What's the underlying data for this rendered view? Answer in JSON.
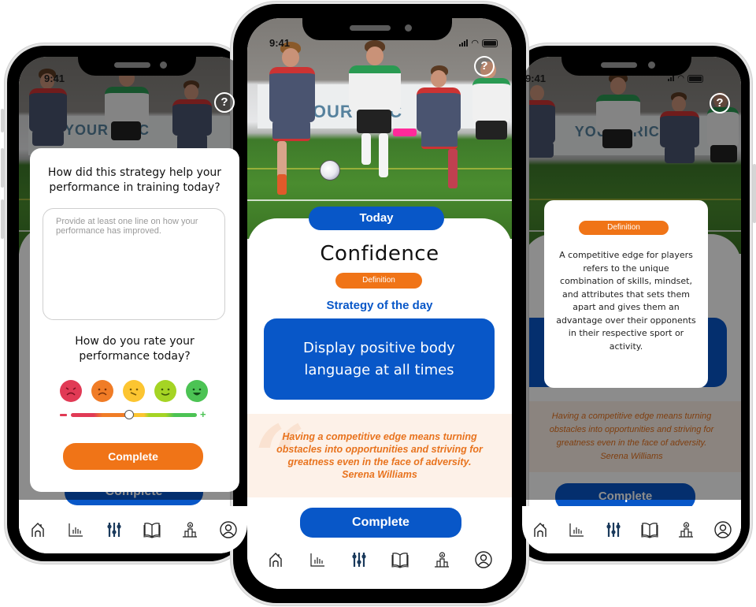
{
  "status_bar": {
    "time": "9:41"
  },
  "left_phone": {
    "help_label": "?",
    "feedback_sheet": {
      "question_1": "How did this strategy help your performance in training today?",
      "textarea_placeholder": "Provide at least one line on how your performance has improved.",
      "textarea_value": "",
      "question_2": "How do you rate your performance today?",
      "rating_options": [
        "very-bad",
        "bad",
        "neutral",
        "good",
        "very-good"
      ],
      "slider_min_label": "−",
      "slider_max_label": "+",
      "slider_value_fraction": 0.46,
      "complete_label": "Complete"
    },
    "background_complete_label": "Complete"
  },
  "center_phone": {
    "help_label": "?",
    "today_label": "Today",
    "skill_title": "Confidence",
    "definition_label": "Definition",
    "strategy_heading": "Strategy of the day",
    "strategy_text": "Display positive body language at all times",
    "quote": {
      "text": "Having a competitive edge means turning obstacles into opportunities and striving for greatness even in the face of adversity.",
      "author": "Serena Williams"
    },
    "complete_label": "Complete"
  },
  "right_phone": {
    "help_label": "?",
    "definition_popup": {
      "label": "Definition",
      "text": "A competitive edge for players refers to the unique combination of skills, mindset, and attributes that sets them apart and gives them an advantage over their opponents in their respective sport or activity."
    },
    "quote": {
      "text": "Having a competitive edge means turning obstacles into opportunities and striving for greatness even in the face of adversity.",
      "author": "Serena Williams"
    },
    "complete_label": "Complete"
  },
  "nav_items": [
    {
      "name": "home",
      "icon": "home-icon",
      "active": false
    },
    {
      "name": "stats",
      "icon": "bar-chart-icon",
      "active": false
    },
    {
      "name": "strategies",
      "icon": "sliders-icon",
      "active": true
    },
    {
      "name": "library",
      "icon": "book-icon",
      "active": false
    },
    {
      "name": "leaderboard",
      "icon": "podium-icon",
      "active": false
    },
    {
      "name": "profile",
      "icon": "user-circle-icon",
      "active": false
    }
  ],
  "colors": {
    "primary_blue": "#0857c8",
    "accent_orange": "#f07417",
    "quote_bg": "#fdf1e8",
    "nav_active": "#1a3a5c"
  }
}
